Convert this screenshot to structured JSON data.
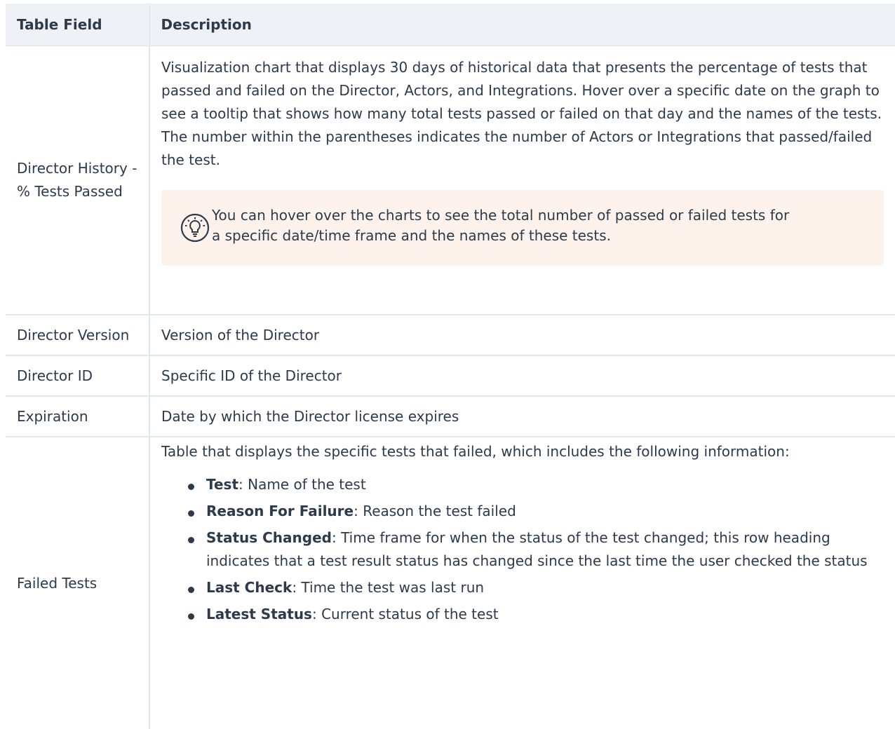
{
  "table": {
    "header": {
      "field": "Table Field",
      "description": "Description"
    },
    "rows": [
      {
        "field": "Director History - % Tests Passed",
        "description": "Visualization chart that displays 30 days of historical data that presents the percentage of tests that passed and failed on the Director, Actors, and Integrations. Hover over a specific date on the graph to see a tooltip that shows how many total tests passed or failed on that day and the names of the tests. The number within the parentheses indicates the number of Actors or Integrations that passed/failed the test.",
        "tip": {
          "icon": "lightbulb-icon",
          "text": "You can hover over the charts to see the total number of passed or failed tests for a specific date/time frame and the names of these tests."
        }
      },
      {
        "field": "Director Version",
        "description": "Version of the Director"
      },
      {
        "field": "Director ID",
        "description": "Specific ID of the Director"
      },
      {
        "field": "Expiration",
        "description": "Date by which the Director license expires"
      },
      {
        "field": "Failed Tests",
        "description": "Table that displays the specific tests that failed, which includes the following information:",
        "items": [
          {
            "term": "Test",
            "text": ": Name of the test"
          },
          {
            "term": "Reason For Failure",
            "text": ": Reason the test failed"
          },
          {
            "term": "Status Changed",
            "text": ": Time frame for when the status of the test changed; this row heading indicates that a test result status has changed since the last time the user checked the status"
          },
          {
            "term": "Last Check",
            "text": ": Time the test was last run"
          },
          {
            "term": "Latest Status",
            "text": ": Current status of the test"
          }
        ]
      }
    ]
  },
  "colors": {
    "header_bg": "#eef1f5",
    "tip_bg": "#fdf3ec",
    "text": "#2d3a4a",
    "border": "#e3e7ec"
  }
}
